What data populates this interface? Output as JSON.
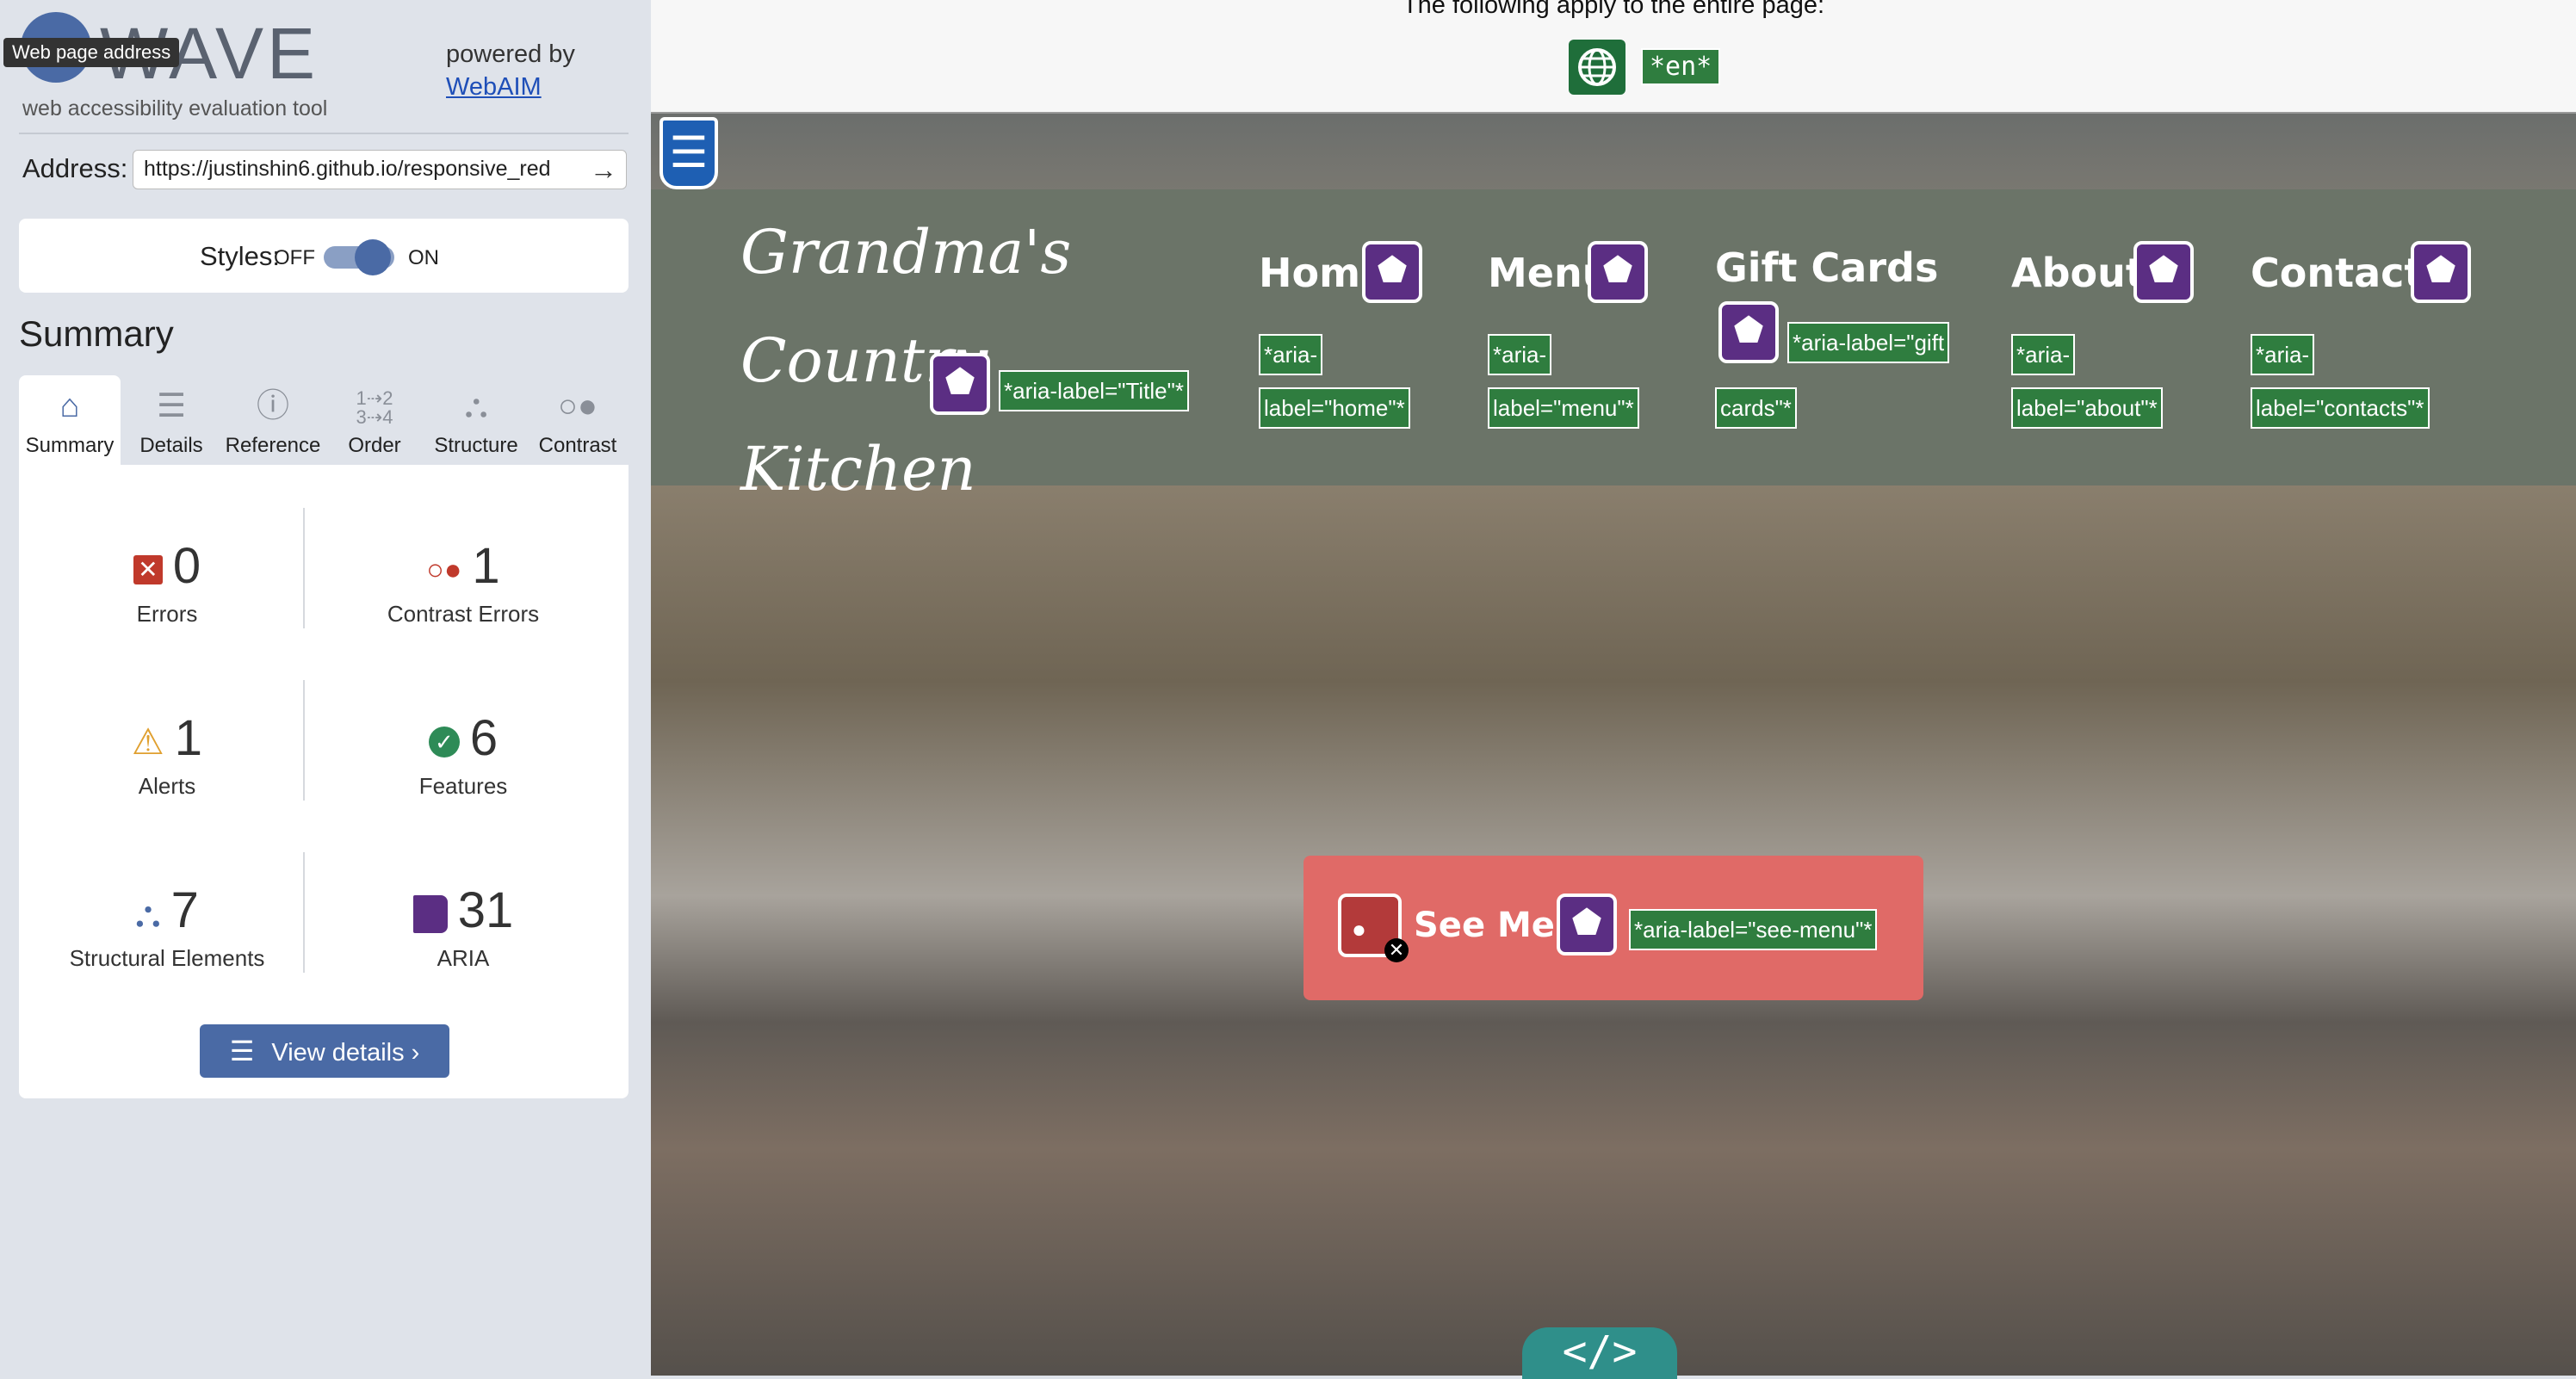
{
  "sidebar": {
    "logo_text": "WAVE",
    "tooltip": "Web page address",
    "tagline": "web accessibility evaluation tool",
    "powered_by": "powered by",
    "webaim_link": "WebAIM",
    "address_label": "Address:",
    "address_value": "https://justinshin6.github.io/responsive_red",
    "styles_label": "Styles:",
    "styles_off": "OFF",
    "styles_on": "ON",
    "styles_enabled": true,
    "summary_title": "Summary",
    "tabs": [
      {
        "label": "Summary",
        "icon": "home-icon",
        "active": true
      },
      {
        "label": "Details",
        "icon": "list-icon",
        "active": false
      },
      {
        "label": "Reference",
        "icon": "info-icon",
        "active": false
      },
      {
        "label": "Order",
        "icon": "order-icon",
        "active": false
      },
      {
        "label": "Structure",
        "icon": "structure-icon",
        "active": false
      },
      {
        "label": "Contrast",
        "icon": "contrast-icon",
        "active": false
      }
    ],
    "metrics": [
      {
        "count": "0",
        "label": "Errors",
        "icon": "error-icon",
        "color": "#c0392b"
      },
      {
        "count": "1",
        "label": "Contrast Errors",
        "icon": "contrast-error-icon",
        "color": "#c0392b"
      },
      {
        "count": "1",
        "label": "Alerts",
        "icon": "alert-icon",
        "color": "#e0a030"
      },
      {
        "count": "6",
        "label": "Features",
        "icon": "feature-icon",
        "color": "#2e8b57"
      },
      {
        "count": "7",
        "label": "Structural Elements",
        "icon": "structure-icon",
        "color": "#4a6aa5"
      },
      {
        "count": "31",
        "label": "ARIA",
        "icon": "aria-icon",
        "color": "#5b2e83"
      }
    ],
    "view_details": "View details ›"
  },
  "page": {
    "notice": "The following apply to the entire page:",
    "lang_tag": "*en*",
    "title_line1": "Grandma's Country",
    "title_line2": "Kitchen",
    "title_aria": "*aria-label=\"Title\"*",
    "nav": [
      {
        "label": "Home",
        "aria1": "*aria-",
        "aria2": "label=\"home\"*"
      },
      {
        "label": "Menu",
        "aria1": "*aria-",
        "aria2": "label=\"menu\"*"
      },
      {
        "label": "Gift Cards",
        "aria1": "*aria-label=\"gift",
        "aria2": "cards\"*"
      },
      {
        "label": "About",
        "aria1": "*aria-",
        "aria2": "label=\"about\"*"
      },
      {
        "label": "Contact",
        "aria1": "*aria-",
        "aria2": "label=\"contacts\"*"
      }
    ],
    "see_menu": "See Menu",
    "see_menu_aria": "*aria-label=\"see-menu\"*",
    "code_toggle": "</>"
  },
  "colors": {
    "accent": "#4a6aa5",
    "aria_purple": "#5b2e83",
    "feature_green": "#2f7d3f",
    "header_band": "#6b7468",
    "button_red": "#e06a67"
  }
}
